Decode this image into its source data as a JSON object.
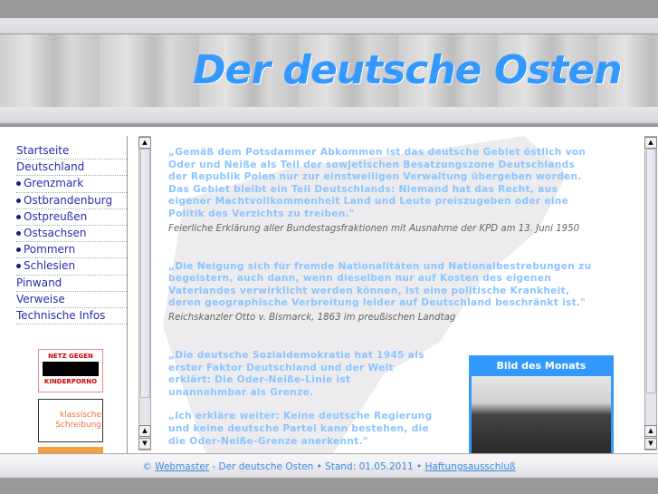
{
  "header": {
    "title": "Der deutsche Osten"
  },
  "nav": {
    "items": [
      {
        "label": "Startseite",
        "sub": false
      },
      {
        "label": "Deutschland",
        "sub": false
      },
      {
        "label": "Grenzmark",
        "sub": true
      },
      {
        "label": "Ostbrandenburg",
        "sub": true
      },
      {
        "label": "Ostpreußen",
        "sub": true
      },
      {
        "label": "Ostsachsen",
        "sub": true
      },
      {
        "label": "Pommern",
        "sub": true
      },
      {
        "label": "Schlesien",
        "sub": true
      },
      {
        "label": "Pinwand",
        "sub": false
      },
      {
        "label": "Verweise",
        "sub": false
      },
      {
        "label": "Technische Infos",
        "sub": false
      }
    ]
  },
  "ads": {
    "ad1_top": "NETZ GEGEN",
    "ad1_bottom": "KINDERPORNO",
    "ad2": "klassische Schreibung"
  },
  "main": {
    "quote1": "„Gemäß dem Potsdammer Abkommen ist das deutsche Gebiet östlich von Oder und Neiße als Teil der sowjetischen Besatzungszone Deutschlands der Republik Polen nur zur einstweiligen Verwaltung übergeben worden. Das Gebiet bleibt ein Teil Deutschlands: Niemand hat das Recht, aus eigener Machtvollkommenheit Land und Leute preiszugeben oder eine Politik des Verzichts zu treiben.\"",
    "source1": "Feierliche Erklärung aller Bundestagsfraktionen mit Ausnahme der KPD am 13. Juni 1950",
    "quote2": "„Die Neigung sich für fremde Nationalitäten und Nationalbestrebungen zu begeistern, auch dann, wenn dieselben nur auf Kosten des eigenen Vaterlandes verwirklicht werden können, ist eine politische Krankheit, deren geographische Verbreitung leider auf Deutschland beschränkt ist.\"",
    "source2": "Reichskanzler Otto v. Bismarck, 1863 im preußischen Landtag",
    "quote3": "„Die deutsche Sozialdemokratie hat 1945 als erster Faktor Deutschland und der Welt erklärt: Die Oder-Neiße-Linie ist unannehmbar als Grenze.",
    "quote4": "„Ich erkläre weiter: Keine deutsche Regierung und keine deutsche Partei kann bestehen, die die Oder-Neiße-Grenze anerkennt.\"",
    "bild_title": "Bild des Monats"
  },
  "footer": {
    "copyright": "©",
    "webmaster": "Webmaster",
    "text": " - Der deutsche Osten • Stand: 01.05.2011 • ",
    "disclaimer": "Haftungsausschluß"
  }
}
